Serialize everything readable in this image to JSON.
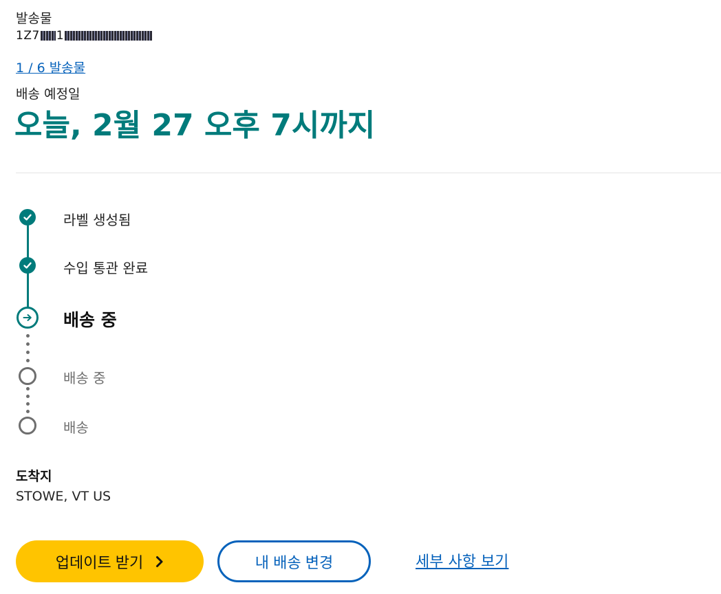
{
  "shipment": {
    "label": "발송물",
    "tracking_prefix": "1Z7",
    "tracking_mid": "1",
    "count_link": "1 / 6 발송물"
  },
  "delivery": {
    "estimate_label": "배송 예정일",
    "estimate_value": "오늘, 2월 27 오후 7시까지"
  },
  "timeline": {
    "steps": [
      {
        "label": "라벨 생성됨",
        "state": "done"
      },
      {
        "label": "수입 통관 완료",
        "state": "done"
      },
      {
        "label": "배송 중",
        "state": "current"
      },
      {
        "label": "배송 중",
        "state": "pending"
      },
      {
        "label": "배송",
        "state": "pending"
      }
    ]
  },
  "destination": {
    "title": "도착지",
    "value": "STOWE, VT US"
  },
  "actions": {
    "primary_label": "업데이트 받기",
    "secondary_label": "내 배송 변경",
    "details_label": "세부 사항 보기"
  },
  "colors": {
    "teal": "#007b7b",
    "blue": "#0662bb",
    "yellow": "#ffc400",
    "gray": "#6e6e6e"
  },
  "icons": {
    "done": "check-icon",
    "current": "arrow-right-icon",
    "button": "chevron-right-icon"
  }
}
